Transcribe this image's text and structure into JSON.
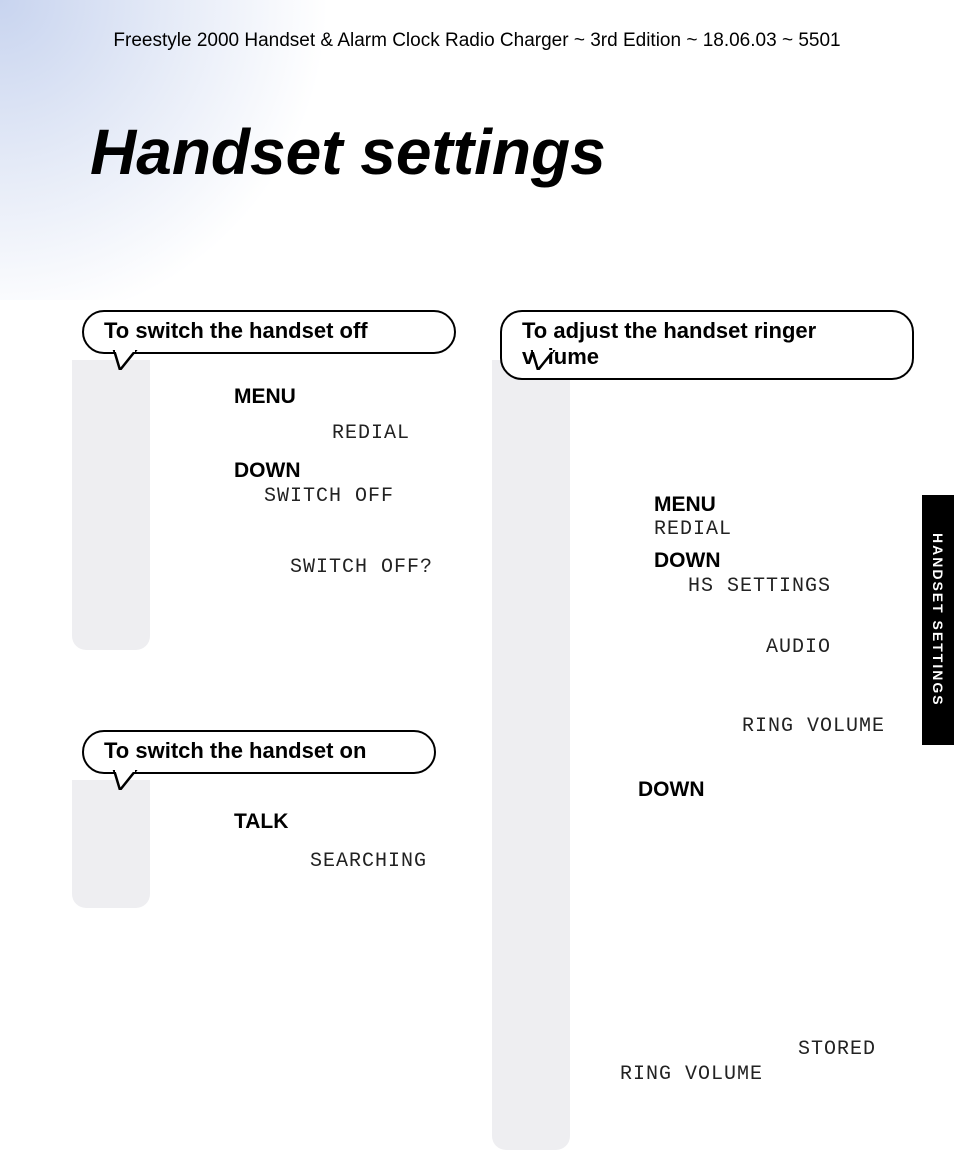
{
  "header": "Freestyle 2000 Handset & Alarm Clock Radio Charger  ~ 3rd Edition ~ 18.06.03 ~ 5501",
  "title": "Handset settings",
  "side_tab": "HANDSET SETTINGS",
  "bubbles": {
    "off": "To switch the handset off",
    "on": "To switch the handset on",
    "vol": "To adjust the handset ringer volume"
  },
  "labels": {
    "menu_btn": "Menu",
    "menu": "MENU",
    "down": "DOWN",
    "talk": "TALK"
  },
  "lcd": {
    "redial": "REDIAL",
    "switch_off": "SWITCH OFF",
    "switch_off_q": "SWITCH OFF?",
    "searching": "SEARCHING",
    "hs_settings": "HS SETTINGS",
    "audio": "AUDIO",
    "ring_volume": "RING VOLUME",
    "stored": "STORED"
  }
}
